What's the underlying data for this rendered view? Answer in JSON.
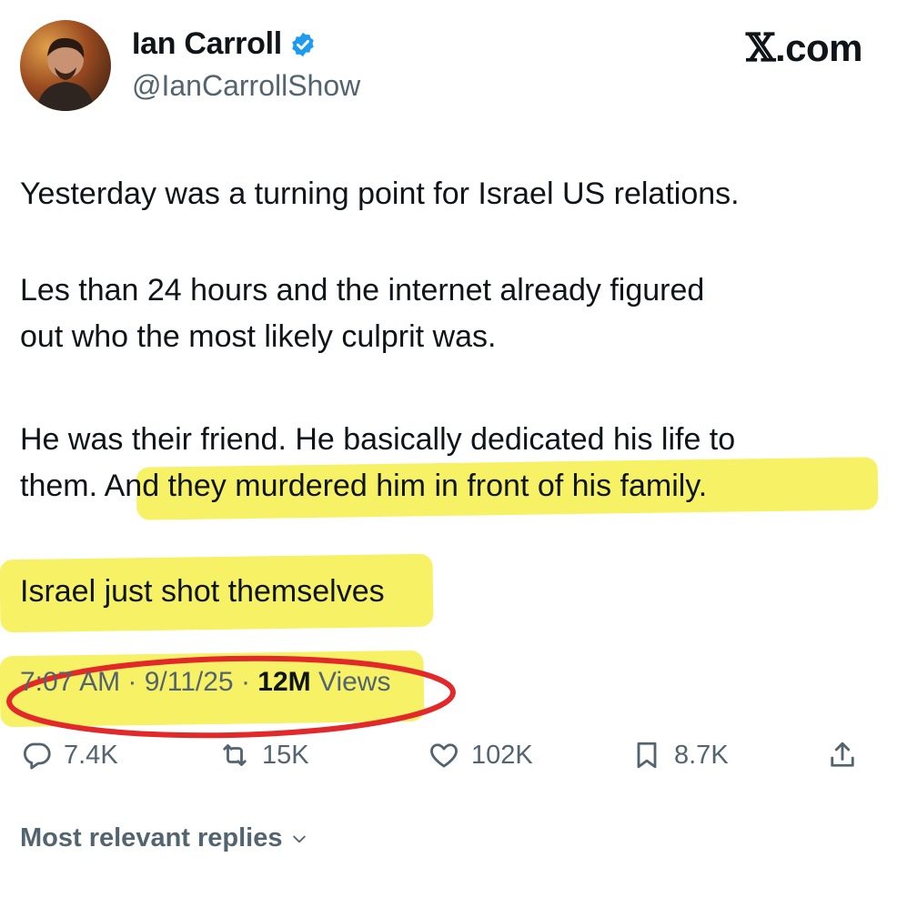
{
  "author": {
    "display_name": "Ian Carroll",
    "handle": "@IanCarrollShow",
    "verified": true
  },
  "site_label": {
    "x": "𝕏",
    "rest": ".com"
  },
  "tweet": {
    "p1": "Yesterday was a turning point for Israel US relations.",
    "p2_l1": "Les than 24 hours and the internet already figured",
    "p2_l2": "out who the most likely culprit was.",
    "p3_l1": "He was their friend. He basically dedicated his life to",
    "p3_l2": "them. And they murdered him in front of his family.",
    "p4": "Israel just shot themselves"
  },
  "meta": {
    "time": "7:07 AM",
    "sep1": " · ",
    "date": "9/11/25",
    "sep2": " · ",
    "views_count": "12M",
    "views_label": " Views"
  },
  "actions": {
    "replies": "7.4K",
    "reposts": "15K",
    "likes": "102K",
    "bookmarks": "8.7K"
  },
  "replies_sort": {
    "label": "Most relevant replies"
  },
  "colors": {
    "highlight": "#f6f04a",
    "circle": "#e3282a",
    "verified": "#1d9bf0",
    "secondary_text": "#536471"
  }
}
